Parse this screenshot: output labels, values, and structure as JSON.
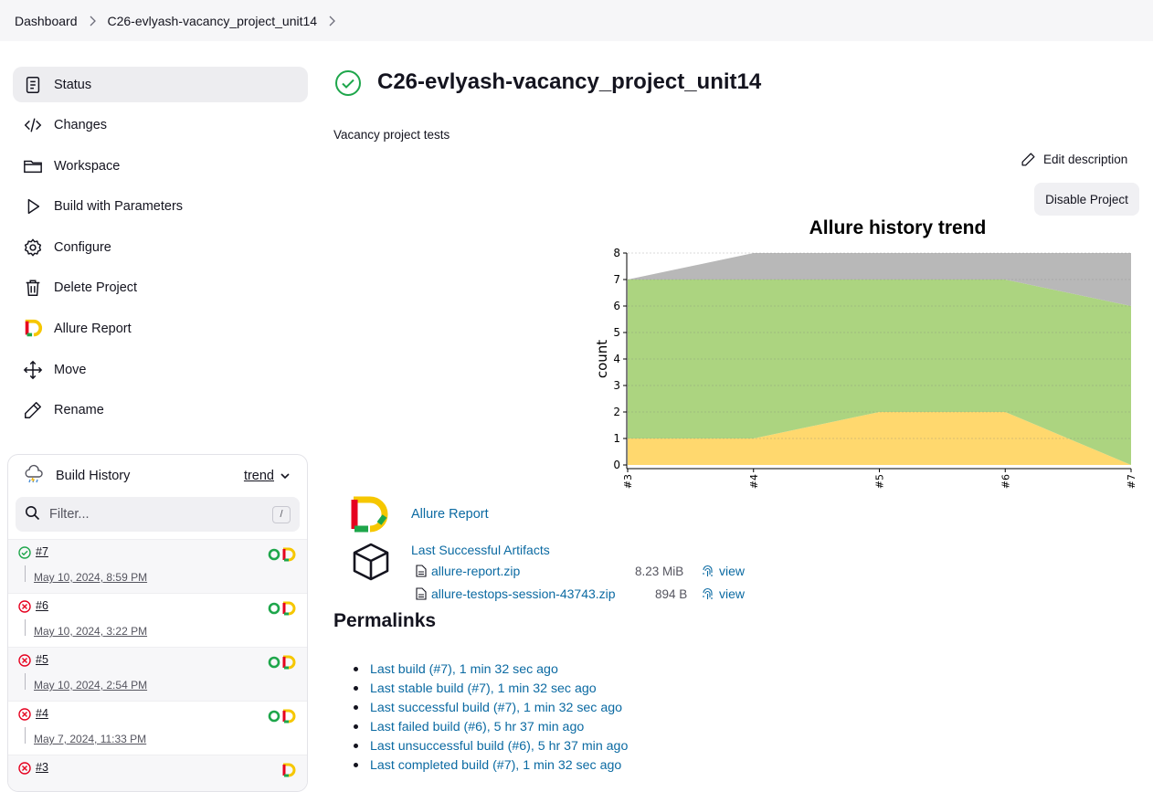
{
  "breadcrumb": {
    "items": [
      "Dashboard",
      "C26-evlyash-vacancy_project_unit14"
    ]
  },
  "sidebar": {
    "items": [
      {
        "label": "Status",
        "icon": "document-icon"
      },
      {
        "label": "Changes",
        "icon": "code-icon"
      },
      {
        "label": "Workspace",
        "icon": "folder-icon"
      },
      {
        "label": "Build with Parameters",
        "icon": "play-icon"
      },
      {
        "label": "Configure",
        "icon": "gear-icon"
      },
      {
        "label": "Delete Project",
        "icon": "trash-icon"
      },
      {
        "label": "Allure Report",
        "icon": "allure-logo-icon"
      },
      {
        "label": "Move",
        "icon": "move-icon"
      },
      {
        "label": "Rename",
        "icon": "pencil-icon"
      }
    ]
  },
  "build_history": {
    "title": "Build History",
    "trend_label": "trend",
    "filter_placeholder": "Filter...",
    "filter_shortcut": "/",
    "builds": [
      {
        "number": "#7",
        "date": "May 10, 2024, 8:59 PM",
        "status": "success"
      },
      {
        "number": "#6",
        "date": "May 10, 2024, 3:22 PM",
        "status": "failed"
      },
      {
        "number": "#5",
        "date": "May 10, 2024, 2:54 PM",
        "status": "failed"
      },
      {
        "number": "#4",
        "date": "May 7, 2024, 11:33 PM",
        "status": "failed"
      },
      {
        "number": "#3",
        "date": "",
        "status": "failed"
      }
    ]
  },
  "main": {
    "title": "C26-evlyash-vacancy_project_unit14",
    "description": "Vacancy project tests",
    "edit_description": "Edit description",
    "disable_project": "Disable Project",
    "allure_report": "Allure Report",
    "artifacts": {
      "title": "Last Successful Artifacts",
      "files": [
        {
          "name": "allure-report.zip",
          "size": "8.23 MiB",
          "view": "view"
        },
        {
          "name": "allure-testops-session-43743.zip",
          "size": "894 B",
          "view": "view"
        }
      ]
    },
    "permalinks": {
      "title": "Permalinks",
      "links": [
        "Last build (#7), 1 min 32 sec ago",
        "Last stable build (#7), 1 min 32 sec ago",
        "Last successful build (#7), 1 min 32 sec ago",
        "Last failed build (#6), 5 hr 37 min ago",
        "Last unsuccessful build (#6), 5 hr 37 min ago",
        "Last completed build (#7), 1 min 32 sec ago"
      ]
    }
  },
  "colors": {
    "success": "#1ea64b",
    "failed": "#e6001f",
    "link": "#0b6aa2",
    "chart_skipped": "#b8b8b8",
    "chart_passed": "#acd480",
    "chart_broken": "#ffd86e"
  },
  "chart_data": {
    "type": "area",
    "title": "Allure history trend",
    "xlabel": "",
    "ylabel": "count",
    "x": [
      "#3",
      "#4",
      "#5",
      "#6",
      "#7"
    ],
    "ylim": [
      0,
      8
    ],
    "yticks": [
      0,
      1,
      2,
      3,
      4,
      5,
      6,
      7,
      8
    ],
    "stacked": true,
    "grid": true,
    "series": [
      {
        "key": "broken",
        "values": [
          1,
          1,
          2,
          2,
          0
        ],
        "color": "#ffd86e"
      },
      {
        "key": "passed",
        "values": [
          6,
          6,
          5,
          5,
          6
        ],
        "color": "#acd480"
      },
      {
        "key": "skipped",
        "values": [
          0,
          1,
          1,
          1,
          2
        ],
        "color": "#b8b8b8"
      }
    ]
  }
}
